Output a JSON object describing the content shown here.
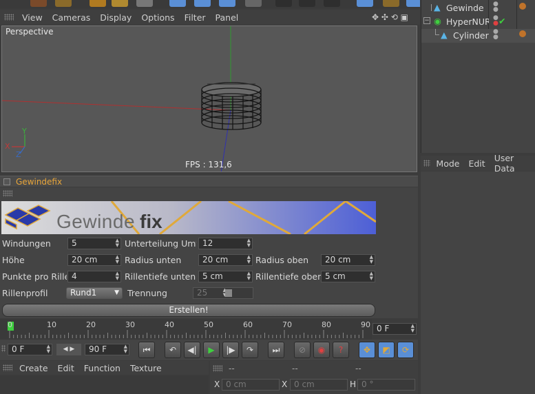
{
  "viewport": {
    "menu": [
      "View",
      "Cameras",
      "Display",
      "Options",
      "Filter",
      "Panel"
    ],
    "label": "Perspective",
    "fps": "FPS : 131,6",
    "axes": {
      "y": "Y",
      "x": "X",
      "z": "Z"
    }
  },
  "plugin": {
    "title": "Gewindefix",
    "banner_text_a": "Gewinde",
    "banner_text_b": "fix",
    "params": {
      "windungen_label": "Windungen",
      "windungen_value": "5",
      "unterteilung_label": "Unterteilung Umfar",
      "unterteilung_value": "12",
      "hoehe_label": "Höhe",
      "hoehe_value": "20 cm",
      "radius_unten_label": "Radius unten",
      "radius_unten_value": "20 cm",
      "radius_oben_label": "Radius oben",
      "radius_oben_value": "20 cm",
      "punkte_label": "Punkte pro Rille",
      "punkte_value": "4",
      "rillentiefe_unten_label": "Rillentiefe unten",
      "rillentiefe_unten_value": "5 cm",
      "rillentiefe_oben_label": "Rillentiefe oben",
      "rillentiefe_oben_value": "5 cm",
      "rillenprofil_label": "Rillenprofil",
      "rillenprofil_value": "Rund1",
      "trennung_label": "Trennung",
      "trennung_value": "25"
    },
    "create_button": "Erstellen!"
  },
  "timeline": {
    "ticks": [
      "0",
      "10",
      "20",
      "30",
      "40",
      "50",
      "60",
      "70",
      "80",
      "90"
    ],
    "current_frame": "0 F"
  },
  "transport": {
    "start_field": "0 F",
    "end_field": "90 F"
  },
  "material_manager": {
    "menu": [
      "Create",
      "Edit",
      "Function",
      "Texture"
    ]
  },
  "coordinates": {
    "header": [
      "--",
      "--",
      "--"
    ],
    "x_label": "X",
    "x_value": "0 cm",
    "x2_label": "X",
    "x2_value": "0 cm",
    "h_label": "H",
    "h_value": "0 °"
  },
  "object_manager": {
    "objects": [
      {
        "name": "Gewinde"
      },
      {
        "name": "HyperNURBS"
      },
      {
        "name": "Cylinder"
      }
    ]
  },
  "attribute_manager": {
    "menu": [
      "Mode",
      "Edit",
      "User Data"
    ]
  },
  "colors": {
    "accent_orange": "#e8a53a",
    "play_green": "#3fcf3f",
    "selected_blue": "#5a8fd6"
  }
}
